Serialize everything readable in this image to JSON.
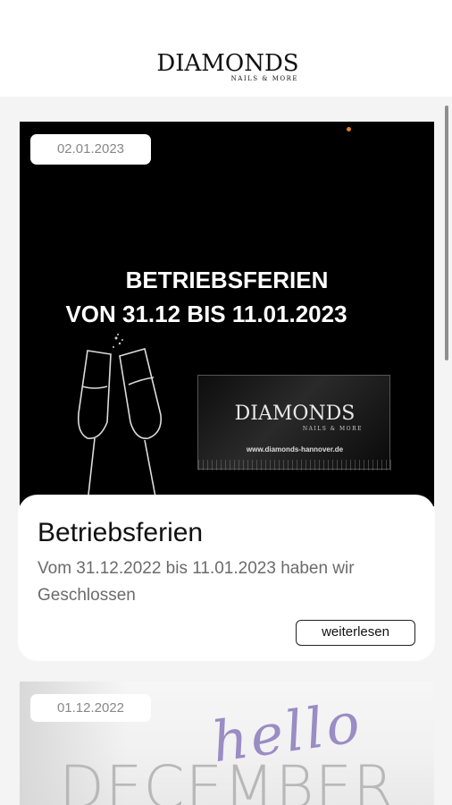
{
  "header": {
    "logo_main": "DIAMONDS",
    "logo_sub": "NAILS & MORE"
  },
  "posts": [
    {
      "date": "02.01.2023",
      "image_line1": "BETRIEBSFERIEN",
      "image_line2": "VON 31.12 BIS 11.01.2023",
      "image_logo": "DIAMONDS",
      "image_logo_sub": "NAILS & MORE",
      "image_url": "www.diamonds-hannover.de",
      "title": "Betriebsferien",
      "description": "Vom 31.12.2022 bis 11.01.2023 haben wir Geschlossen",
      "read_more": "weiterlesen"
    },
    {
      "date": "01.12.2022",
      "image_script": "hello",
      "image_word": "DECEMBER"
    }
  ],
  "colors": {
    "background": "#f4f4f4",
    "card": "#ffffff",
    "hello_accent": "#9a8cc4",
    "dot_accent": "#e08020"
  }
}
